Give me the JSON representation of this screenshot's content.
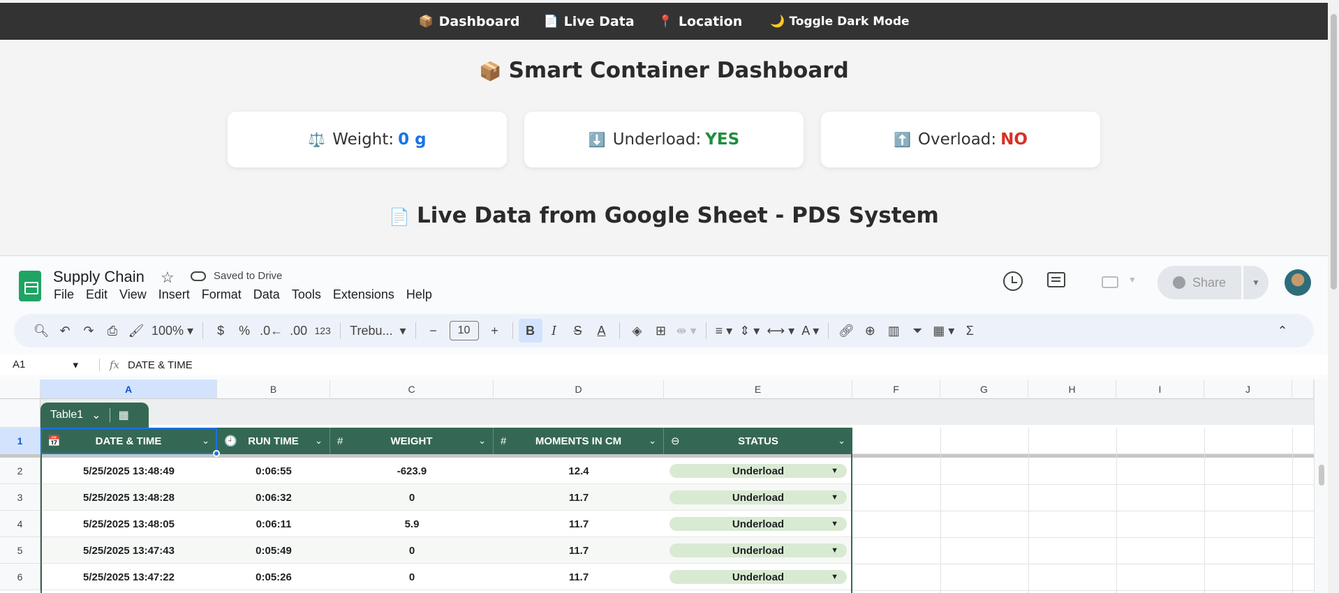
{
  "nav": {
    "items": [
      {
        "icon": "📦",
        "label": "Dashboard"
      },
      {
        "icon": "📄",
        "label": "Live Data"
      },
      {
        "icon": "📍",
        "label": "Location"
      }
    ],
    "dark_toggle": {
      "icon": "🌙",
      "label": "Toggle Dark Mode"
    }
  },
  "dashboard": {
    "title_icon": "📦",
    "title": "Smart Container Dashboard",
    "cards": [
      {
        "icon": "⚖️",
        "label": "Weight: ",
        "value": "0 g",
        "value_color": "#1a73e8"
      },
      {
        "icon": "⬇️",
        "label": "Underload: ",
        "value": "YES",
        "value_color": "#1e8e3e"
      },
      {
        "icon": "⬆️",
        "label": "Overload: ",
        "value": "NO",
        "value_color": "#d93025"
      }
    ],
    "section_icon": "📄",
    "section_title": "Live Data from Google Sheet - PDS System"
  },
  "sheet": {
    "doc_title": "Supply Chain",
    "saved_status": "Saved to Drive",
    "menu": [
      "File",
      "Edit",
      "View",
      "Insert",
      "Format",
      "Data",
      "Tools",
      "Extensions",
      "Help"
    ],
    "share_label": "Share",
    "toolbar": {
      "zoom": "100%",
      "currency": "$",
      "percent": "%",
      "dec_decrease": ".0←",
      "dec_increase": ".00",
      "number_format": "123",
      "font": "Trebu...",
      "font_size": "10"
    },
    "name_box": "A1",
    "formula": "DATE & TIME",
    "column_letters": [
      "A",
      "B",
      "C",
      "D",
      "E",
      "F",
      "G",
      "H",
      "I",
      "J"
    ],
    "row_numbers": [
      "1",
      "2",
      "3",
      "4",
      "5",
      "6"
    ],
    "table_name": "Table1",
    "headers": [
      {
        "icon": "📅",
        "label": "DATE & TIME"
      },
      {
        "icon": "🕘",
        "label": "RUN TIME"
      },
      {
        "icon": "#",
        "label": "WEIGHT"
      },
      {
        "icon": "#",
        "label": "MOMENTS IN CM"
      },
      {
        "icon": "⊖",
        "label": "STATUS"
      }
    ],
    "rows": [
      [
        "5/25/2025 13:48:49",
        "0:06:55",
        "-623.9",
        "12.4",
        "Underload"
      ],
      [
        "5/25/2025 13:48:28",
        "0:06:32",
        "0",
        "11.7",
        "Underload"
      ],
      [
        "5/25/2025 13:48:05",
        "0:06:11",
        "5.9",
        "11.7",
        "Underload"
      ],
      [
        "5/25/2025 13:47:43",
        "0:05:49",
        "0",
        "11.7",
        "Underload"
      ],
      [
        "5/25/2025 13:47:22",
        "0:05:26",
        "0",
        "11.7",
        "Underload"
      ]
    ]
  }
}
